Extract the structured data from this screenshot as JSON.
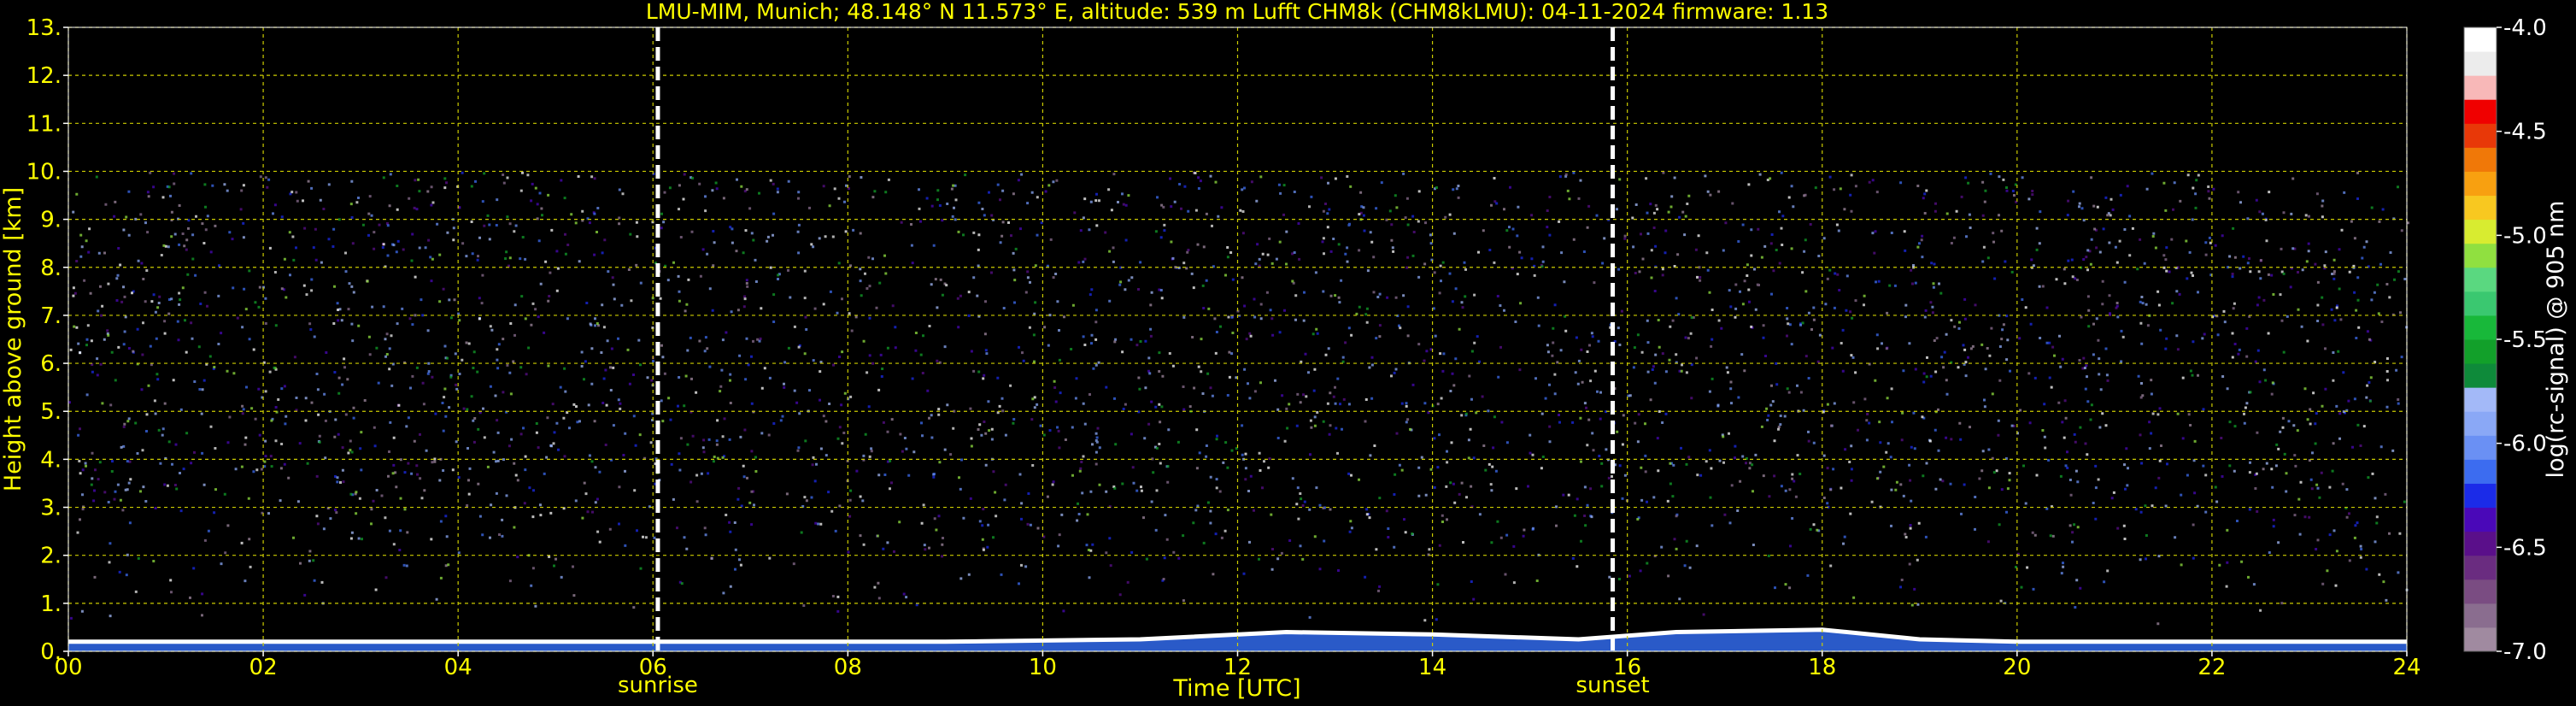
{
  "chart_data": {
    "type": "heatmap",
    "title": "LMU-MIM, Munich; 48.148° N 11.573° E, altitude: 539 m    Lufft CHM8k (CHM8kLMU): 04-11-2024    firmware: 1.13",
    "xlabel": "Time [UTC]",
    "ylabel": "Height above ground [km]",
    "xlim": [
      0,
      24
    ],
    "ylim": [
      0,
      13
    ],
    "x_ticks": [
      "00",
      "02",
      "04",
      "06",
      "08",
      "10",
      "12",
      "14",
      "16",
      "18",
      "20",
      "22",
      "24"
    ],
    "y_ticks": [
      "0.",
      "1.",
      "2.",
      "3.",
      "4.",
      "5.",
      "6.",
      "7.",
      "8.",
      "9.",
      "10.",
      "11.",
      "12.",
      "13."
    ],
    "grid": true,
    "markers": [
      {
        "label": "sunrise",
        "x": 6.05
      },
      {
        "label": "sunset",
        "x": 15.85
      }
    ],
    "signal_top_km": 10.0,
    "boundary_layer": [
      [
        0,
        0.2
      ],
      [
        4,
        0.2
      ],
      [
        6,
        0.2
      ],
      [
        9,
        0.2
      ],
      [
        11,
        0.25
      ],
      [
        12.5,
        0.4
      ],
      [
        14,
        0.35
      ],
      [
        15.5,
        0.25
      ],
      [
        16.5,
        0.4
      ],
      [
        18,
        0.45
      ],
      [
        19,
        0.25
      ],
      [
        20,
        0.2
      ],
      [
        24,
        0.2
      ]
    ],
    "colorbar": {
      "label": "log(rc-signal) @ 905 nm",
      "range": [
        -7.0,
        -4.0
      ],
      "ticks": [
        "-4.0",
        "-4.5",
        "-5.0",
        "-5.5",
        "-6.0",
        "-6.5",
        "-7.0"
      ],
      "colors": [
        "#a08aa0",
        "#8a6d8f",
        "#7a4c82",
        "#6a2c80",
        "#5a0f8a",
        "#4a08b8",
        "#1b2be8",
        "#3c6cf0",
        "#6a90f4",
        "#8aa8f6",
        "#a3b9f8",
        "#0e8a3a",
        "#12a02a",
        "#18b83a",
        "#3ac870",
        "#5ad880",
        "#90e040",
        "#d8ec30",
        "#f8c820",
        "#f8a010",
        "#f07808",
        "#e83808",
        "#f00000",
        "#f8b8b8",
        "#ececec",
        "#ffffff"
      ]
    }
  }
}
